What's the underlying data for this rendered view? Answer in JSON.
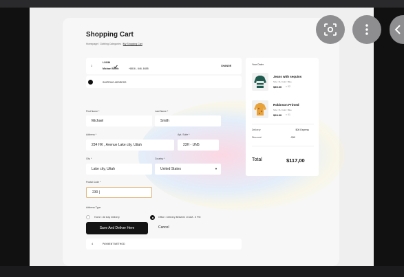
{
  "cart": {
    "title": "Shopping Cart",
    "breadcrumb": {
      "home": "Homepage",
      "sep1": "/",
      "category": "Clothing Categories",
      "sep2": "/",
      "current": "My Shopping Cart"
    },
    "login": {
      "step": "1",
      "label": "LOGIN",
      "name": "Michael Smith",
      "phone": "+8816 - 646 -8455",
      "change": "CHANGE"
    },
    "shipping": {
      "label": "SHIPPING ADDRESS"
    },
    "form": {
      "first_name_label": "First Name *",
      "first_name": "Michael",
      "last_name_label": "Last Name *",
      "last_name": "Smith",
      "address_label": "Address *",
      "address": "234 HK , Avenue Lake city, Uttah",
      "apt_label": "Apt. Suite *",
      "apt": "23H - UN5",
      "city_label": "City *",
      "city": "Lake city, Uttah",
      "country_label": "Country *",
      "country": "United States",
      "postal_label": "Postal Code *",
      "postal": "230 |",
      "address_type_label": "Address Type",
      "home_option": "Home : All Day Delivery",
      "office_option": "Office : Delivery Between 10 AM - 5 PM"
    },
    "buttons": {
      "save": "Save And Deliver Here",
      "cancel": "Cancel"
    },
    "payment": {
      "step": "4",
      "label": "PAYMENT METHOD"
    },
    "order": {
      "title": "Your Order",
      "items": [
        {
          "name": "Jeans with sequins",
          "meta": "Size: XL   Color: Blue",
          "price": "$39.00",
          "qty": "× 02"
        },
        {
          "name": "Robinson Printed",
          "meta": "Size: XL   Color: Blue",
          "price": "$29.00",
          "qty": "× 01"
        }
      ],
      "delivery_label": "Delivery",
      "delivery_value": "$00 Express",
      "discount_label": "Discount",
      "discount_value": "-$10",
      "total_label": "Total",
      "total_value": "$117,00"
    }
  },
  "overlay": {
    "lens_icon": "lens-icon",
    "more_icon": "more-vertical-icon",
    "back_icon": "chevron-left-icon"
  },
  "colors": {
    "primary": "#141414",
    "active_border": "#e2b57a",
    "fab": "#8e8e91"
  }
}
